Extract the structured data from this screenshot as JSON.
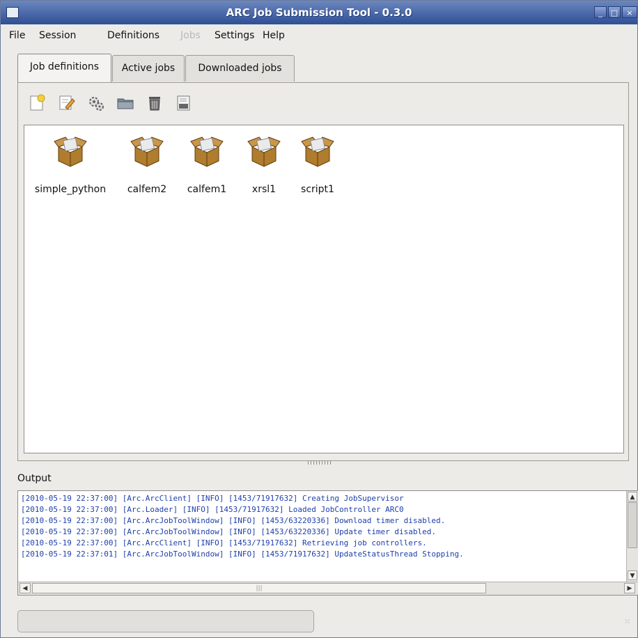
{
  "window": {
    "title": "ARC Job Submission Tool - 0.3.0",
    "controls": [
      "minimize",
      "maximize",
      "close"
    ]
  },
  "menu": [
    {
      "label": "File",
      "enabled": true
    },
    {
      "label": "Session",
      "enabled": true
    },
    {
      "label": "Definitions",
      "enabled": true
    },
    {
      "label": "Jobs",
      "enabled": false
    },
    {
      "label": "Settings",
      "enabled": true
    },
    {
      "label": "Help",
      "enabled": true
    }
  ],
  "tabs": [
    {
      "label": "Job definitions",
      "active": true
    },
    {
      "label": "Active jobs",
      "active": false
    },
    {
      "label": "Downloaded jobs",
      "active": false
    }
  ],
  "toolbar": [
    {
      "icon": "new-document-icon"
    },
    {
      "icon": "edit-icon"
    },
    {
      "icon": "gears-icon"
    },
    {
      "icon": "folder-icon"
    },
    {
      "icon": "trash-icon"
    },
    {
      "icon": "xrsl-icon",
      "badge": "RSL"
    }
  ],
  "job_definitions": [
    {
      "name": "simple_python",
      "icon": "package-icon"
    },
    {
      "name": "calfem2",
      "icon": "package-icon"
    },
    {
      "name": "calfem1",
      "icon": "package-icon"
    },
    {
      "name": "xrsl1",
      "icon": "package-icon"
    },
    {
      "name": "script1",
      "icon": "package-icon"
    }
  ],
  "output": {
    "label": "Output",
    "lines": [
      "[2010-05-19 22:37:00] [Arc.ArcClient] [INFO] [1453/71917632] Creating JobSupervisor",
      "[2010-05-19 22:37:00] [Arc.Loader] [INFO] [1453/71917632] Loaded JobController ARC0",
      "[2010-05-19 22:37:00] [Arc.ArcJobToolWindow] [INFO] [1453/63220336] Download timer disabled.",
      "[2010-05-19 22:37:00] [Arc.ArcJobToolWindow] [INFO] [1453/63220336] Update timer disabled.",
      "[2010-05-19 22:37:00] [Arc.ArcClient] [INFO] [1453/71917632] Retrieving job controllers.",
      "[2010-05-19 22:37:01] [Arc.ArcJobToolWindow] [INFO] [1453/71917632] UpdateStatusThread Stopping."
    ]
  },
  "colors": {
    "titlebar": "#3d5ea3",
    "log_text": "#1d3faa",
    "window_bg": "#ecebe8"
  }
}
